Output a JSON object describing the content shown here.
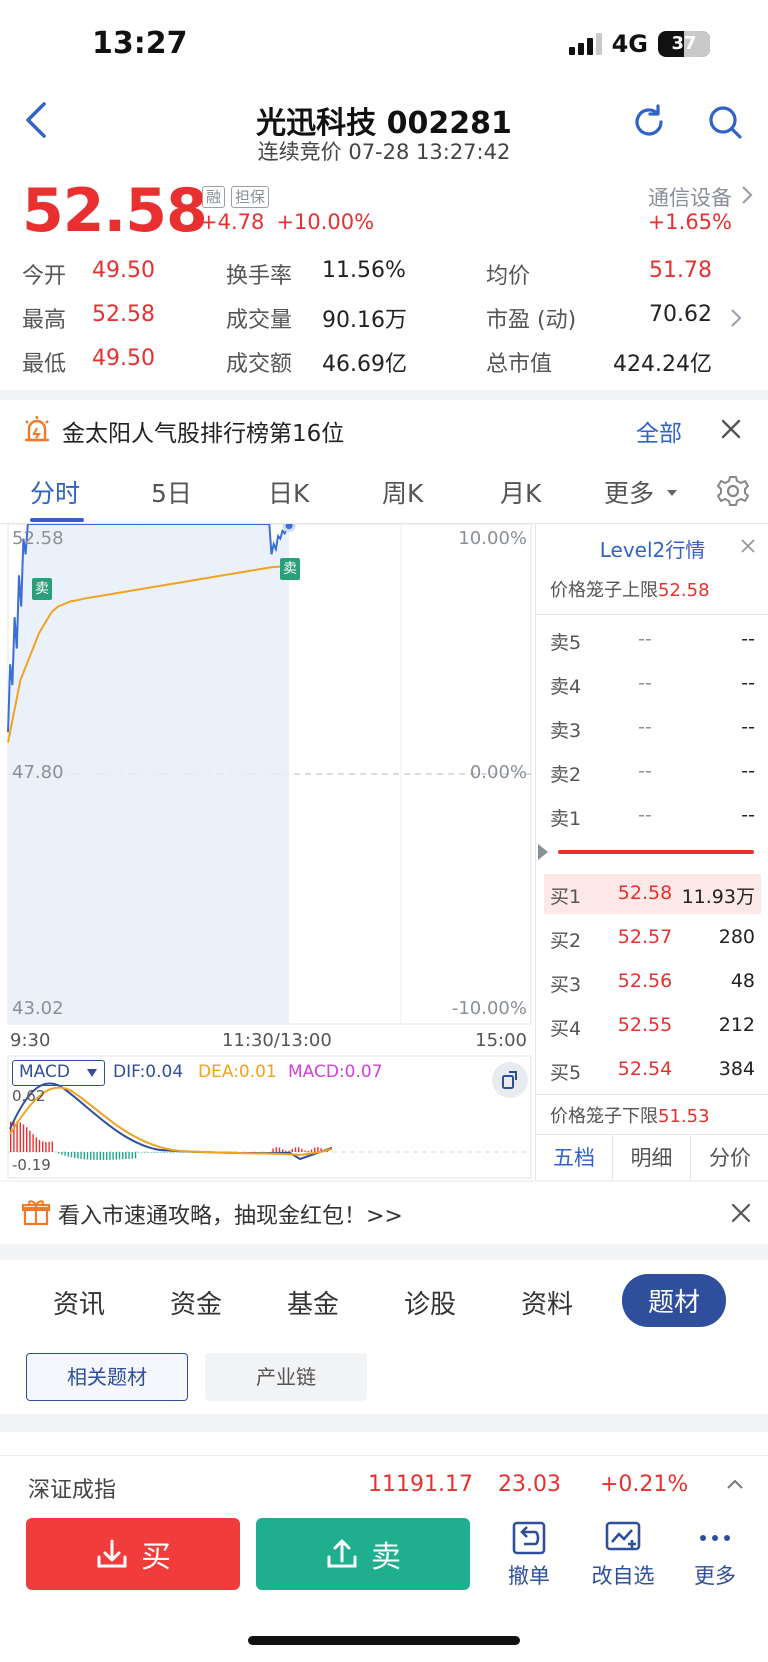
{
  "status": {
    "time": "13:27",
    "network": "4G",
    "battery": "37"
  },
  "header": {
    "title": "光迅科技 002281",
    "subtitle": "连续竞价 07-28 13:27:42"
  },
  "quote": {
    "price": "52.58",
    "tag1": "融",
    "tag2": "担保",
    "change": "+4.78",
    "change_pct": "+10.00%",
    "sector": "通信设备",
    "sector_pct": "+1.65%"
  },
  "stats": {
    "open_label": "今开",
    "open": "49.50",
    "turnover_label": "换手率",
    "turnover": "11.56%",
    "avg_label": "均价",
    "avg": "51.78",
    "high_label": "最高",
    "high": "52.58",
    "volume_label": "成交量",
    "volume": "90.16万",
    "pe_label": "市盈 (动)",
    "pe": "70.62",
    "low_label": "最低",
    "low": "49.50",
    "amount_label": "成交额",
    "amount": "46.69亿",
    "mcap_label": "总市值",
    "mcap": "424.24亿"
  },
  "banner": {
    "text": "金太阳人气股排行榜第16位",
    "all": "全部"
  },
  "chart_tabs": [
    "分时",
    "5日",
    "日K",
    "周K",
    "月K",
    "更多"
  ],
  "chart_data": {
    "type": "line",
    "title": "",
    "y_labels": {
      "top": "52.58",
      "mid": "47.80",
      "bottom": "43.02"
    },
    "pct_labels": {
      "top": "10.00%",
      "mid": "0.00%",
      "bottom": "-10.00%"
    },
    "x_labels": [
      "9:30",
      "11:30/13:00",
      "15:00"
    ],
    "ylim": [
      43.02,
      52.58
    ],
    "sell_marker": "卖",
    "series": [
      {
        "values": [
          48.6,
          49.9,
          49.5,
          50.8,
          50.2,
          51.6,
          51.0,
          52.3,
          52.0,
          52.58,
          52.58,
          52.58,
          52.58,
          52.58,
          52.58,
          52.58,
          52.58,
          52.58,
          52.58,
          52.58,
          52.58,
          52.58,
          52.58,
          52.58,
          52.58,
          52.58,
          52.58,
          52.58,
          52.58,
          52.58,
          52.58,
          52.58,
          52.58,
          52.58,
          52.58,
          52.58,
          52.58,
          52.58,
          52.58,
          52.58,
          52.58,
          52.58,
          52.58,
          52.58,
          52.58,
          52.58,
          52.58,
          52.58,
          52.58,
          52.58,
          52.58,
          52.58,
          52.58,
          52.58,
          52.58,
          52.58,
          52.58,
          52.58,
          52.58,
          52.58,
          52.58,
          52.58,
          52.58,
          52.58,
          52.58,
          52.58,
          52.58,
          52.58,
          52.58,
          52.58,
          52.58,
          52.58,
          52.58,
          52.58,
          52.58,
          52.58,
          52.58,
          52.58,
          52.58,
          52.58,
          52.58,
          52.58,
          52.58,
          52.58,
          52.58,
          52.58,
          52.58,
          52.58,
          52.58,
          52.58,
          52.58,
          52.58,
          52.58,
          52.58,
          52.58,
          52.58,
          52.58,
          52.58,
          52.58,
          52.58,
          52.58,
          52.58,
          52.58,
          52.58,
          52.58,
          52.58,
          52.58,
          52.58,
          52.58,
          52.58,
          52.58,
          52.58,
          52.58,
          52.58,
          52.58,
          52.58,
          52.58,
          52.58,
          52.58,
          52.58,
          52.0,
          52.2,
          52.1,
          52.35,
          52.3,
          52.45,
          52.4,
          52.5,
          52.55
        ]
      },
      {
        "values": [
          48.4,
          49.0,
          49.6,
          49.9,
          50.2,
          50.5,
          50.7,
          50.9,
          51.0,
          51.05,
          51.1,
          51.12,
          51.15,
          51.17,
          51.19,
          51.21,
          51.23,
          51.25,
          51.27,
          51.29,
          51.31,
          51.33,
          51.35,
          51.37,
          51.39,
          51.41,
          51.43,
          51.45,
          51.47,
          51.49,
          51.51,
          51.53,
          51.55,
          51.57,
          51.59,
          51.61,
          51.63,
          51.65,
          51.67,
          51.69,
          51.71,
          51.73,
          51.75,
          51.76,
          51.77,
          51.78
        ]
      }
    ]
  },
  "macd": {
    "indicator": "MACD",
    "dif": "DIF:0.04",
    "dea": "DEA:0.01",
    "macd": "MACD:0.07",
    "top": "0.62",
    "bottom": "-0.19"
  },
  "level2": {
    "title": "Level2行情",
    "upper_limit_label": "价格笼子上限",
    "upper_limit": "52.58",
    "lower_limit_label": "价格笼子下限",
    "lower_limit": "51.53",
    "asks": [
      {
        "label": "卖5",
        "price": "--",
        "vol": "--"
      },
      {
        "label": "卖4",
        "price": "--",
        "vol": "--"
      },
      {
        "label": "卖3",
        "price": "--",
        "vol": "--"
      },
      {
        "label": "卖2",
        "price": "--",
        "vol": "--"
      },
      {
        "label": "卖1",
        "price": "--",
        "vol": "--"
      }
    ],
    "bids": [
      {
        "label": "买1",
        "price": "52.58",
        "vol": "11.93万"
      },
      {
        "label": "买2",
        "price": "52.57",
        "vol": "280"
      },
      {
        "label": "买3",
        "price": "52.56",
        "vol": "48"
      },
      {
        "label": "买4",
        "price": "52.55",
        "vol": "212"
      },
      {
        "label": "买5",
        "price": "52.54",
        "vol": "384"
      }
    ],
    "tabs": [
      "五档",
      "明细",
      "分价"
    ]
  },
  "promo": {
    "text": "看入市速通攻略，抽现金红包！>>"
  },
  "section_tabs": [
    "资讯",
    "资金",
    "基金",
    "诊股",
    "资料",
    "题材"
  ],
  "chips": [
    "相关题材",
    "产业链"
  ],
  "ticker": {
    "name": "深证成指",
    "value": "11191.17",
    "change": "23.03",
    "pct": "+0.21%"
  },
  "toolbar": {
    "buy": "买",
    "sell": "卖",
    "cancel": "撤单",
    "watch": "改自选",
    "more": "更多"
  },
  "colors": {
    "up": "#e93030",
    "down": "#1fa68a",
    "accent": "#2f63c7",
    "navy": "#2f4f9c"
  }
}
